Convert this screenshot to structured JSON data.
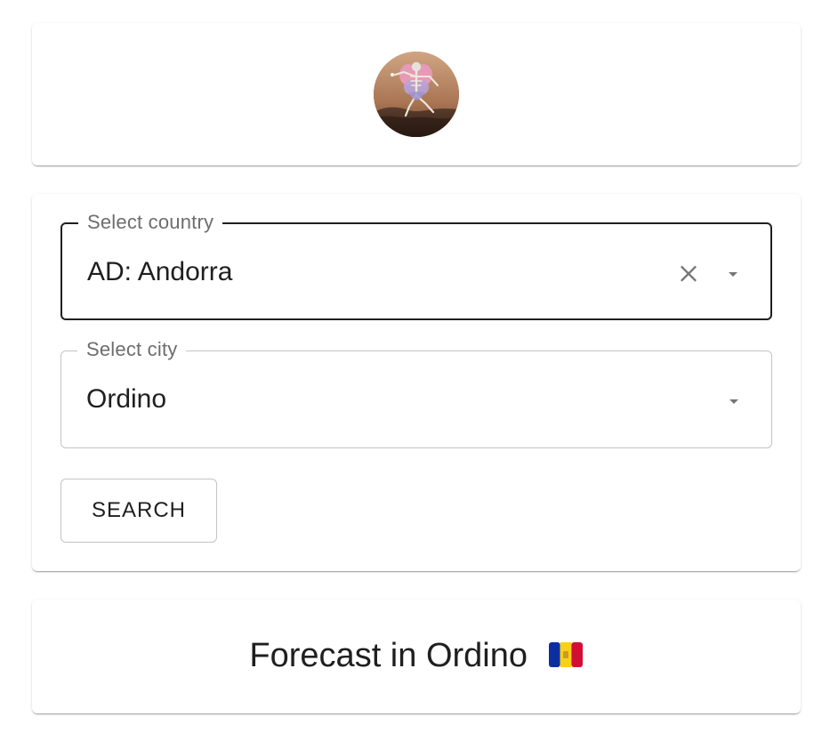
{
  "avatar": {
    "icon": "winged-skeleton-avatar-icon"
  },
  "country_select": {
    "label": "Select country",
    "value": "AD: Andorra",
    "clear_icon": "close-icon",
    "dropdown_icon": "dropdown-arrow-icon"
  },
  "city_select": {
    "label": "Select city",
    "value": "Ordino",
    "dropdown_icon": "dropdown-arrow-icon"
  },
  "search_button": {
    "label": "SEARCH"
  },
  "forecast": {
    "title": "Forecast in Ordino",
    "flag_icon": "andorra-flag-icon"
  },
  "colors": {
    "text": "#1f1f1f",
    "label": "#6d6d6d",
    "border_focused": "#1f1f1f",
    "border_default": "#c4c4c4",
    "card_background": "#ffffff",
    "icon": "#757575",
    "andorra_blue": "#0b2fa1",
    "andorra_yellow": "#f7d116",
    "andorra_red": "#d10f34"
  }
}
